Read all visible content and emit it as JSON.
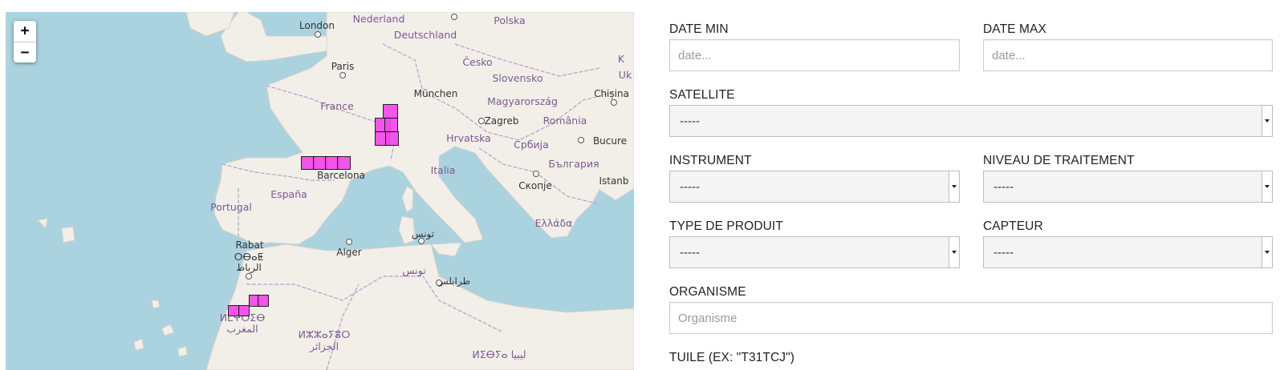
{
  "map": {
    "zoom_in_label": "+",
    "zoom_out_label": "−",
    "colors": {
      "water": "#aad3df",
      "land": "#f2efe9",
      "tile_fill": "#f14ae8",
      "border": "#b89ec7"
    },
    "labels": {
      "nederland": "Nederland",
      "polska": "Polska",
      "london": "London",
      "deutschland": "Deutschland",
      "cesko": "Česko",
      "paris": "Paris",
      "slovensko": "Slovensko",
      "munchen": "München",
      "chisina": "Chișina",
      "france": "France",
      "magyarorszag": "Magyarország",
      "zagreb": "Zagreb",
      "romania": "România",
      "hrvatska": "Hrvatska",
      "srbija": "Србија",
      "bucure": "Bucure",
      "balgariya": "България",
      "barcelona": "Barcelona",
      "italia": "Italia",
      "skopje": "Скопје",
      "istanb": "Istanb",
      "espana": "España",
      "portugal": "Portugal",
      "ellada": "Ελλάδα",
      "tunis": "تونس",
      "rabat": "Rabat",
      "rabat_tifinagh": "ⵔⴱⴰⵟ",
      "rabat_ar": "الرباط",
      "alger": "Alger",
      "tounes": "تونس",
      "tarabulus": "طرابلس",
      "maghrib_tifinagh": "ⵍⵎⵖⵔⵉⴱ",
      "maghrib_ar": "المغرب",
      "dzayer_tifinagh": "ⵍⵣⵣⴰⵢⴻⵔ",
      "dzayer_ar": "الجزائر",
      "libya": "ⵍⵉⴱⵢⴰ ليبيا",
      "edge_k": "K",
      "edge_u": "Uk"
    }
  },
  "form": {
    "date_min": {
      "label": "DATE MIN",
      "placeholder": "date..."
    },
    "date_max": {
      "label": "DATE MAX",
      "placeholder": "date..."
    },
    "satellite": {
      "label": "SATELLITE",
      "value": "-----"
    },
    "instrument": {
      "label": "INSTRUMENT",
      "value": "-----"
    },
    "niveau": {
      "label": "NIVEAU DE TRAITEMENT",
      "value": "-----"
    },
    "type_produit": {
      "label": "TYPE DE PRODUIT",
      "value": "-----"
    },
    "capteur": {
      "label": "CAPTEUR",
      "value": "-----"
    },
    "organisme": {
      "label": "ORGANISME",
      "placeholder": "Organisme"
    },
    "tuile": {
      "label": "TUILE (EX: \"T31TCJ\")"
    }
  }
}
